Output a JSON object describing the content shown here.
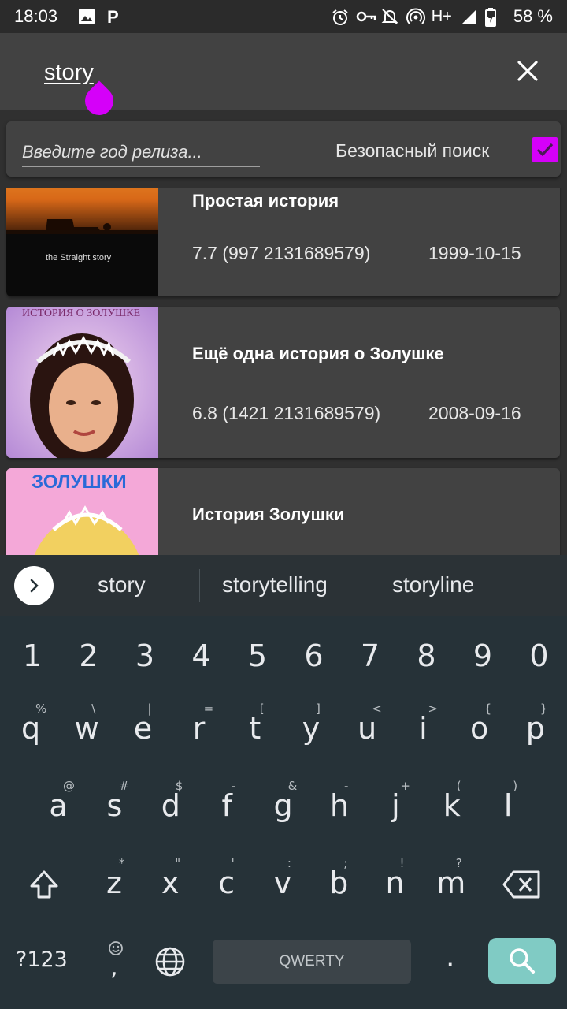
{
  "status_bar": {
    "time": "18:03",
    "network": "H+",
    "battery": "58 %"
  },
  "search": {
    "query": "story",
    "clear_icon": "close-icon"
  },
  "filters": {
    "year_placeholder": "Введите год релиза...",
    "safe_search_label": "Безопасный поиск",
    "safe_search_checked": true,
    "accent_color": "#d500f9"
  },
  "results": [
    {
      "title": "Простая история",
      "rating": "7.7 (997 2131689579)",
      "date": "1999-10-15",
      "poster_caption": "the Straight story"
    },
    {
      "title": "Ещё одна история о Золушке",
      "rating": "6.8 (1421 2131689579)",
      "date": "2008-09-16",
      "poster_caption": "ИСТОРИЯ О ЗОЛУШКЕ"
    },
    {
      "title": "История Золушки",
      "rating": "",
      "date": "",
      "poster_caption": "ЗОЛУШКИ"
    }
  ],
  "suggestions": [
    "story",
    "storytelling",
    "storyline"
  ],
  "keyboard": {
    "numbers": [
      "1",
      "2",
      "3",
      "4",
      "5",
      "6",
      "7",
      "8",
      "9",
      "0"
    ],
    "row1": [
      {
        "k": "q",
        "h": "%"
      },
      {
        "k": "w",
        "h": "\\"
      },
      {
        "k": "e",
        "h": "|"
      },
      {
        "k": "r",
        "h": "="
      },
      {
        "k": "t",
        "h": "["
      },
      {
        "k": "y",
        "h": "]"
      },
      {
        "k": "u",
        "h": "<"
      },
      {
        "k": "i",
        "h": ">"
      },
      {
        "k": "o",
        "h": "{"
      },
      {
        "k": "p",
        "h": "}"
      }
    ],
    "row2": [
      {
        "k": "a",
        "h": "@"
      },
      {
        "k": "s",
        "h": "#"
      },
      {
        "k": "d",
        "h": "$"
      },
      {
        "k": "f",
        "h": "-"
      },
      {
        "k": "g",
        "h": "&"
      },
      {
        "k": "h",
        "h": "-"
      },
      {
        "k": "j",
        "h": "+"
      },
      {
        "k": "k",
        "h": "("
      },
      {
        "k": "l",
        "h": ")"
      }
    ],
    "row3": [
      {
        "k": "z",
        "h": "*"
      },
      {
        "k": "x",
        "h": "\""
      },
      {
        "k": "c",
        "h": "'"
      },
      {
        "k": "v",
        "h": ":"
      },
      {
        "k": "b",
        "h": ";"
      },
      {
        "k": "n",
        "h": "!"
      },
      {
        "k": "m",
        "h": "?"
      }
    ],
    "symbols_label": "?123",
    "comma": ",",
    "space_label": "QWERTY",
    "period": ".",
    "search_key_color": "#80cbc4"
  }
}
